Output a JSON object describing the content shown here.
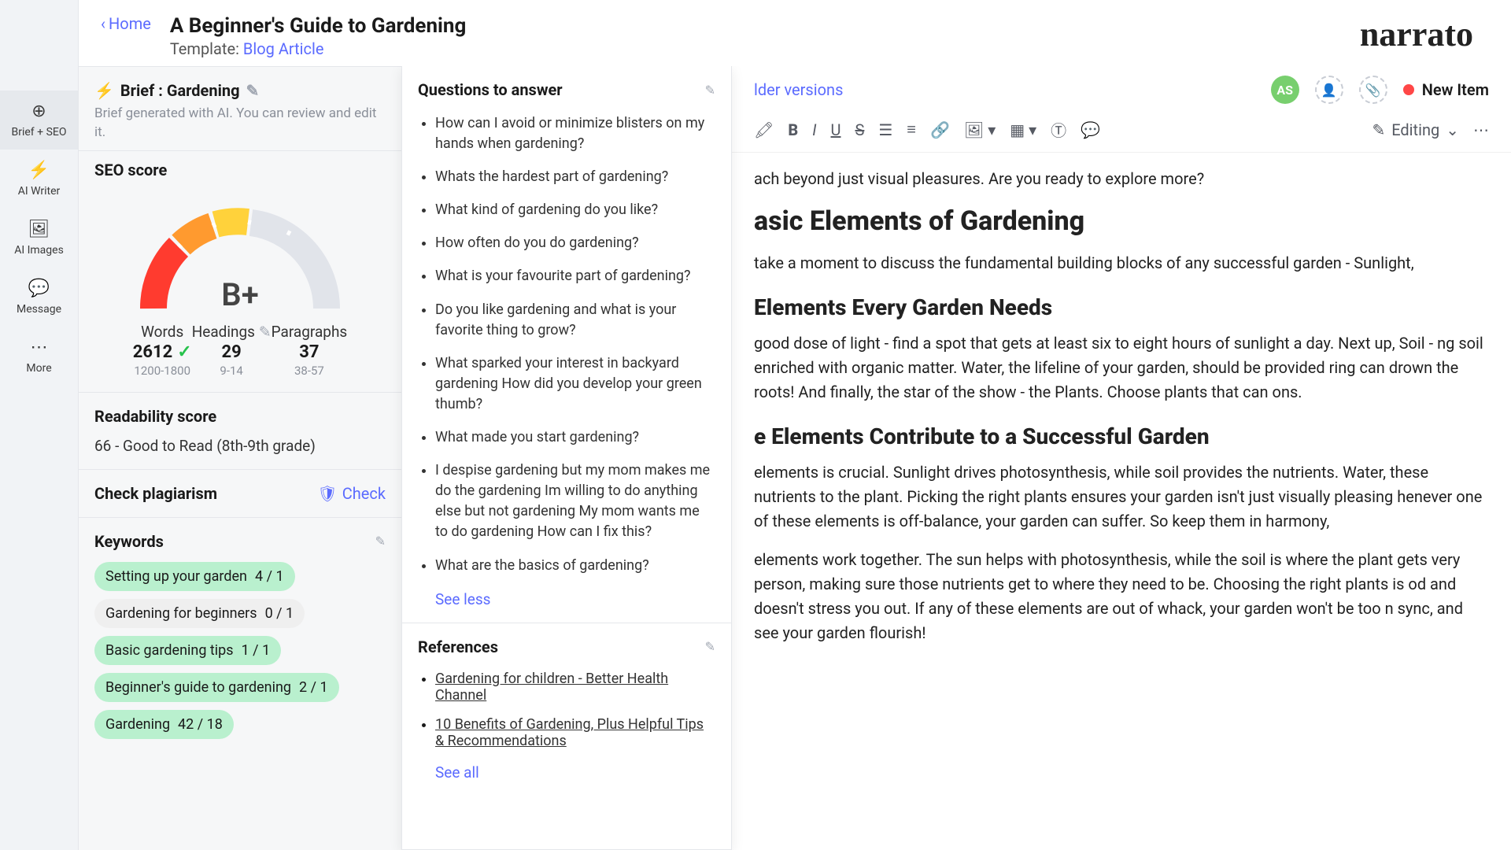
{
  "header": {
    "home": "Home",
    "title": "A Beginner's Guide to Gardening",
    "template_prefix": "Template: ",
    "template_link": "Blog Article",
    "logo": "narrato"
  },
  "leftnav": {
    "brief_seo": "Brief + SEO",
    "ai_writer": "AI Writer",
    "ai_images": "AI Images",
    "message": "Message",
    "more": "More"
  },
  "brief": {
    "title": "Brief : Gardening",
    "subtitle": "Brief generated with AI. You can review and edit it."
  },
  "seo": {
    "title": "SEO score",
    "grade": "B+",
    "words_label": "Words",
    "words_value": "2612",
    "words_range": "1200-1800",
    "headings_label": "Headings",
    "headings_value": "29",
    "headings_range": "9-14",
    "paragraphs_label": "Paragraphs",
    "paragraphs_value": "37",
    "paragraphs_range": "38-57"
  },
  "readability": {
    "title": "Readability score",
    "text": "66 - Good to Read (8th-9th grade)"
  },
  "plagiarism": {
    "title": "Check plagiarism",
    "check": "Check"
  },
  "keywords": {
    "title": "Keywords",
    "items": [
      {
        "label": "Setting up your garden",
        "count": "4 / 1",
        "class": "green"
      },
      {
        "label": "Gardening for beginners",
        "count": "0 / 1",
        "class": "gray"
      },
      {
        "label": "Basic gardening tips",
        "count": "1 / 1",
        "class": "green"
      },
      {
        "label": "Beginner's guide to gardening",
        "count": "2 / 1",
        "class": "green"
      },
      {
        "label": "Gardening",
        "count": "42 / 18",
        "class": "green"
      }
    ]
  },
  "questions": {
    "title": "Questions to answer",
    "items": [
      "How can I avoid or minimize blisters on my hands when gardening?",
      "Whats the hardest part of gardening?",
      "What kind of gardening do you like?",
      "How often do you do gardening?",
      "What is your favourite part of gardening?",
      "Do you like gardening and what is your favorite thing to grow?",
      "What sparked your interest in backyard gardening How did you develop your green thumb?",
      "What made you start gardening?",
      "I despise gardening but my mom makes me do the gardening Im willing to do anything else but not gardening My mom wants me to do gardening How can I fix this?",
      "What are the basics of gardening?"
    ],
    "see_less": "See less"
  },
  "references": {
    "title": "References",
    "items": [
      "Gardening for children - Better Health Channel",
      "10 Benefits of Gardening, Plus Helpful Tips & Recommendations"
    ],
    "see_all": "See all"
  },
  "editor_top": {
    "older_versions": "lder versions",
    "avatar": "AS",
    "new_item": "New Item"
  },
  "toolbar": {
    "editing": "Editing"
  },
  "doc": {
    "p1": "ach beyond just visual pleasures. Are you ready to explore more?",
    "h2_1": "asic Elements of Gardening",
    "p2": " take a moment to discuss the fundamental building blocks of any successful garden - Sunlight,",
    "h3_1": "Elements Every Garden Needs",
    "p3": "good dose of light - find a spot that gets at least six to eight hours of sunlight a day. Next up, Soil - ng soil enriched with organic matter. Water, the lifeline of your garden, should be provided ring can drown the roots! And finally, the star of the show - the Plants. Choose plants that can ons.",
    "h3_2": "e Elements Contribute to a Successful Garden",
    "p4": " elements is crucial. Sunlight drives photosynthesis, while soil provides the nutrients. Water, these nutrients to the plant. Picking the right plants ensures your garden isn't just visually pleasing henever one of these elements is off-balance, your garden can suffer. So keep them in harmony,",
    "p5": " elements work together. The sun helps with photosynthesis, while the soil is where the plant gets very person, making sure those nutrients get to where they need to be. Choosing the right plants is od and doesn't stress you out. If any of these elements are out of whack, your garden won't be too n sync, and see your garden flourish!"
  }
}
